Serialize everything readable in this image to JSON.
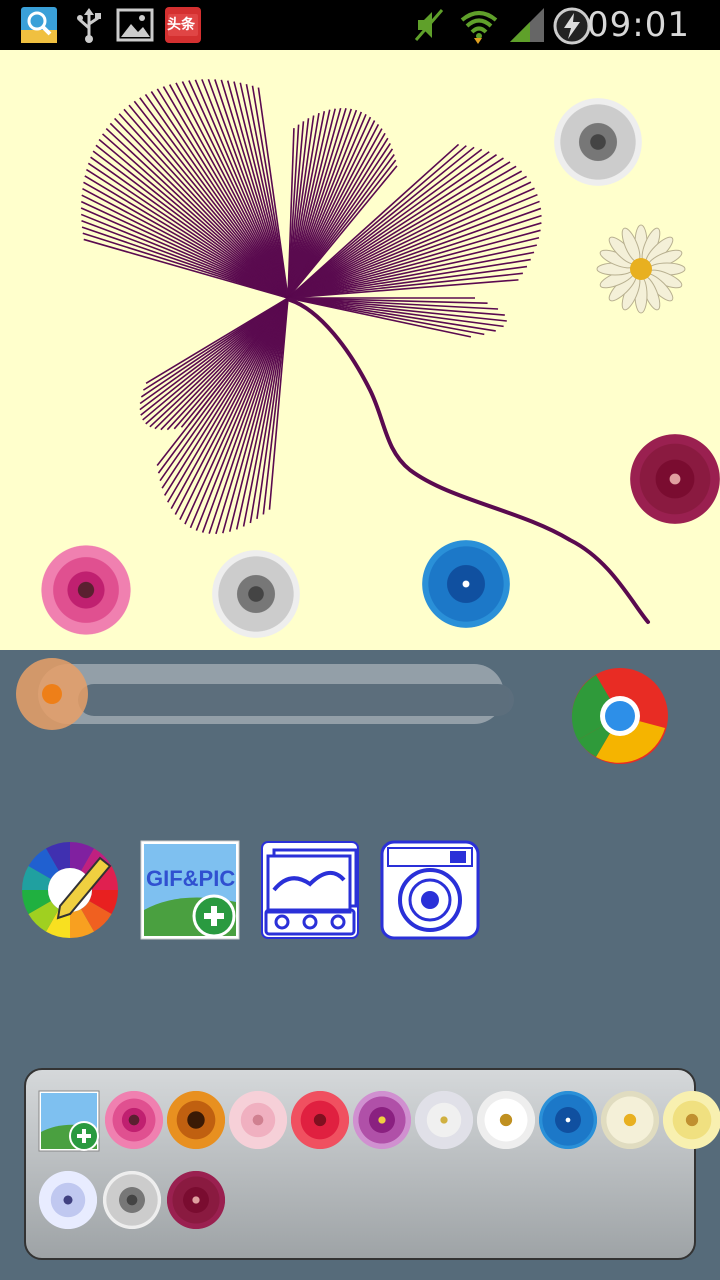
{
  "status_bar": {
    "time": "09:01",
    "icons": [
      "search-app-icon",
      "usb-icon",
      "image-icon",
      "toutiao-app-icon",
      "mute-icon",
      "wifi-icon",
      "signal-icon",
      "battery-charging-icon"
    ],
    "toutiao_label": "头条"
  },
  "canvas": {
    "background": "#ffffcc",
    "stroke_color": "#5a0a4f",
    "placed_flowers": [
      "gray-dandelion",
      "white-daisy",
      "crimson-star-flower",
      "pink-flower",
      "gray-dandelion",
      "blue-flower"
    ]
  },
  "brush_slider": {
    "value": 0.0
  },
  "browser_button": {
    "icon": "chrome-icon"
  },
  "tools": [
    {
      "name": "color-palette",
      "icon": "color-wheel-pencil-icon"
    },
    {
      "name": "gif-pic",
      "icon": "gif-add-icon",
      "label": "GIF&PIC"
    },
    {
      "name": "gallery",
      "icon": "stamp-gallery-icon"
    },
    {
      "name": "camera",
      "icon": "camera-icon"
    }
  ],
  "tray": {
    "add_icon": "add-image-icon",
    "flowers": [
      "pink-flower",
      "orange-sunflower",
      "light-pink-flower",
      "red-flower",
      "purple-flower",
      "white-lily",
      "white-flower",
      "blue-flower",
      "white-daisy",
      "yellow-flower",
      "blue-white-flower",
      "gray-dandelion",
      "crimson-star-flower"
    ]
  }
}
